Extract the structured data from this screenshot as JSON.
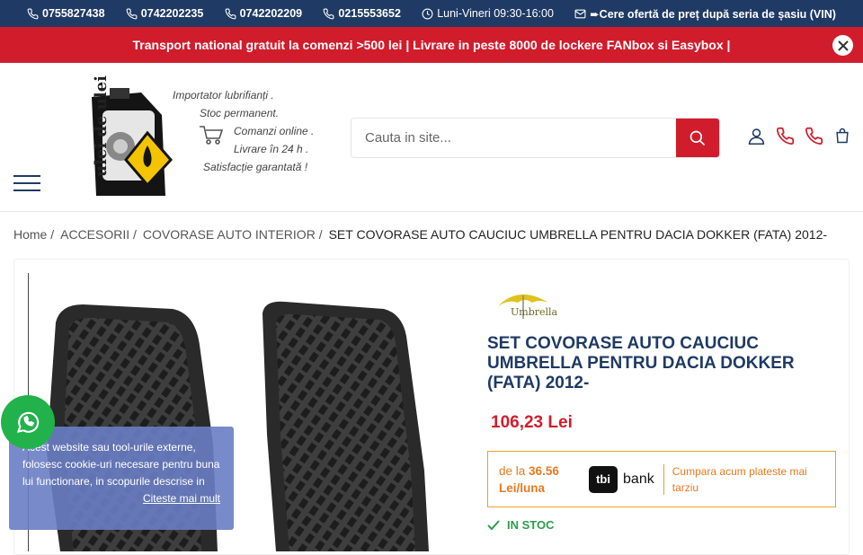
{
  "topbar": {
    "phones": [
      "0755827438",
      "0742202235",
      "0742202209",
      "0215553652"
    ],
    "hours": "Luni-Vineri 09:30-16:00",
    "offer": "➨Cere ofertă de preț după seria de șasiu (VIN)"
  },
  "promo": {
    "text": "Transport national gratuit la comenzi >500 lei | Livrare in peste 8000 de lockere FANbox si Easybox |"
  },
  "logo": {
    "brand_text": "ulei de ulei",
    "lines": [
      "Importator lubrifianți .",
      "Stoc permanent.",
      "Comanzi online .",
      "Livrare în 24 h .",
      "Satisfacție garantată !"
    ]
  },
  "search": {
    "placeholder": "Cauta in site..."
  },
  "breadcrumb": {
    "items": [
      "Home /",
      "ACCESORII /",
      "COVORASE AUTO INTERIOR /"
    ],
    "current": "SET COVORASE AUTO CAUCIUC UMBRELLA PENTRU DACIA DOKKER (FATA) 2012-"
  },
  "product": {
    "brand": "Umbrella",
    "title": "SET COVORASE AUTO CAUCIUC UMBRELLA PENTRU DACIA DOKKER (FATA) 2012-",
    "price": "106,23 Lei",
    "credit": {
      "from": "de la",
      "amount": "36.56",
      "unit": "Lei/luna",
      "bank_box": "tbi",
      "bank_word": "bank",
      "pay_later": "Cumpara acum plateste mai tarziu"
    },
    "stock": "IN STOC"
  },
  "cookie": {
    "text": "Acest website sau tool-urile externe, folosesc cookie-uri necesare pentru buna lui functionare, in scopurile descrise in",
    "more": "Citeste mai mult"
  },
  "colors": {
    "navy": "#1f3a64",
    "red": "#d11c2c",
    "orange": "#e8791e",
    "green": "#2a9d4a",
    "whatsapp": "#22b24c"
  }
}
